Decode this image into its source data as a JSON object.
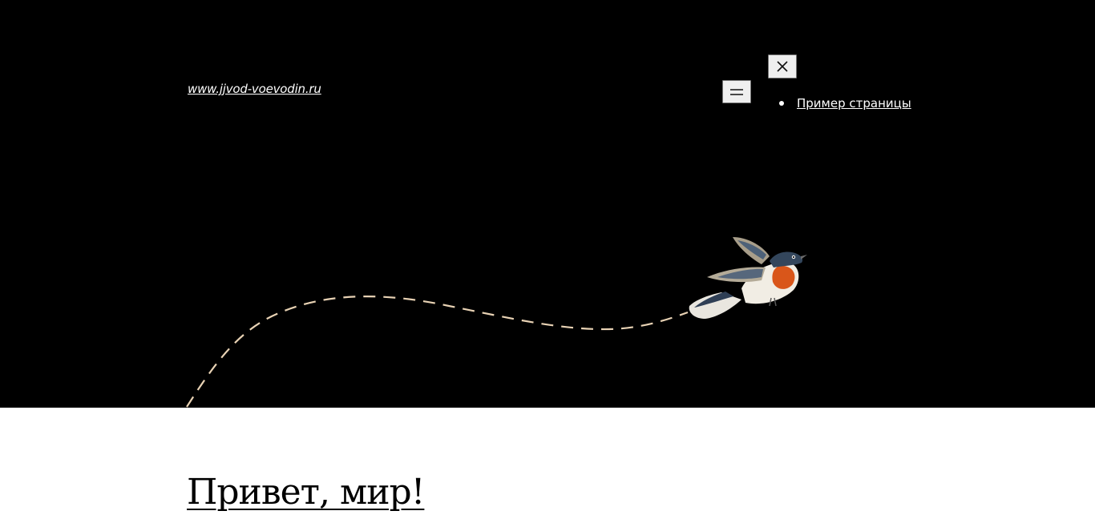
{
  "site": {
    "title": "www.jjvod-voevodin.ru"
  },
  "navigation": {
    "menu_button_icon": "hamburger-icon",
    "close_button_icon": "close-icon",
    "items": [
      {
        "label": "Пример страницы"
      }
    ]
  },
  "post": {
    "title": "Привет, мир!"
  },
  "colors": {
    "header_background": "#000000",
    "page_background": "#ffffff",
    "dashed_path": "#e8d2b4"
  }
}
